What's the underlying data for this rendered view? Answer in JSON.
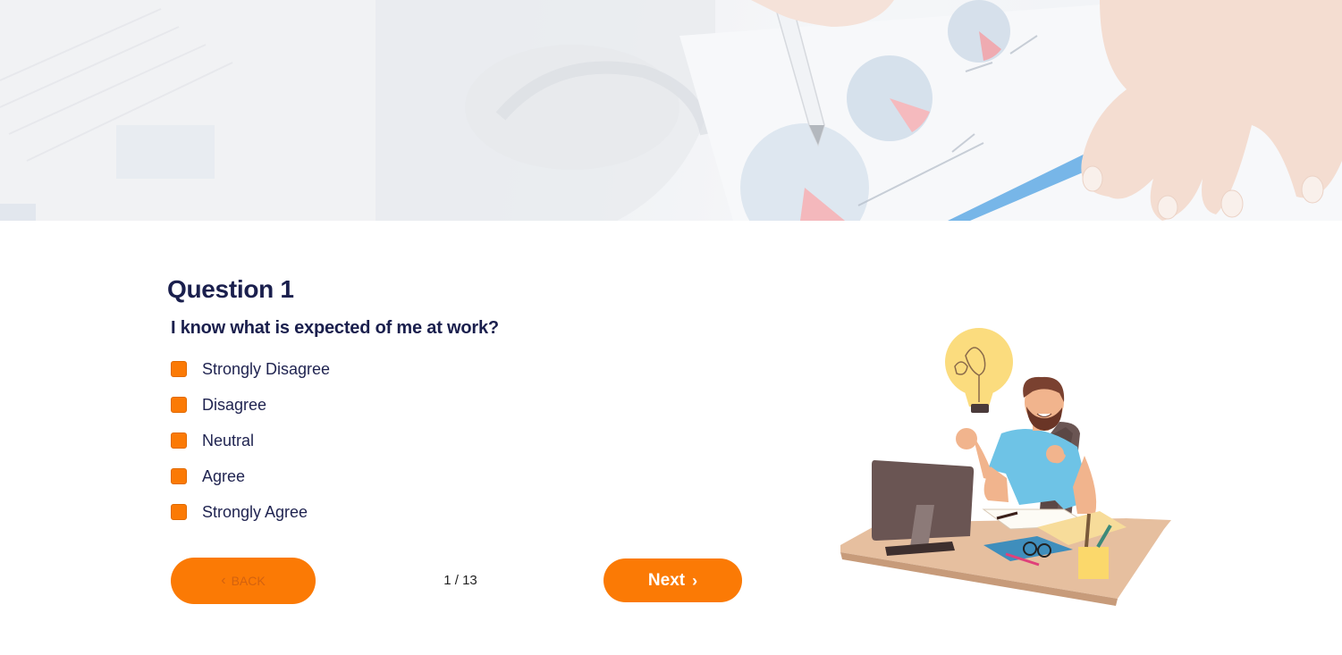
{
  "hero": {
    "image": "office-analytics-banner"
  },
  "question": {
    "title": "Question 1",
    "text": "I know what is expected of me at work?"
  },
  "options": [
    {
      "label": "Strongly Disagree"
    },
    {
      "label": "Disagree"
    },
    {
      "label": "Neutral"
    },
    {
      "label": "Agree"
    },
    {
      "label": "Strongly Agree"
    }
  ],
  "navigation": {
    "back_label": "BACK",
    "back_icon": "chevron-left-icon",
    "progress": "1 / 13",
    "next_label": "Next",
    "next_icon": "chevron-right-icon"
  },
  "illustration": "man-at-desk-with-lightbulb",
  "colors": {
    "accent": "#fb7a05",
    "heading": "#1a1f4d",
    "text": "#1f2350",
    "background": "#ffffff"
  }
}
